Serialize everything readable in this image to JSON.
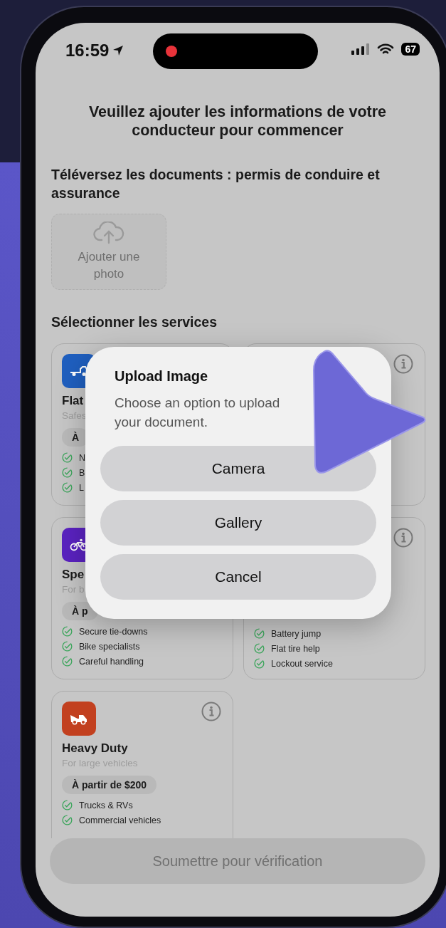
{
  "status_bar": {
    "time": "16:59",
    "battery": "67"
  },
  "title": "Veuillez ajouter les informations de votre conducteur pour commencer",
  "upload": {
    "label": "Téléversez les documents : permis de conduire et assurance",
    "button": "Ajouter une photo"
  },
  "services": {
    "heading": "Sélectionner les services",
    "cards": [
      {
        "kind": "truck",
        "color": "#1f5fbf",
        "name": "Flat",
        "subtitle": "Safes",
        "price": "À",
        "features": [
          "N",
          "B",
          "L"
        ]
      },
      {
        "kind": "hidden"
      },
      {
        "kind": "bike",
        "color": "#5a22c0",
        "name": "Spe",
        "subtitle": "For b",
        "price": "À p",
        "features": [
          "Secure tie-downs",
          "Bike specialists",
          "Careful handling"
        ]
      },
      {
        "kind": "hidden",
        "features": [
          "Battery jump",
          "Flat tire help",
          "Lockout service"
        ]
      },
      {
        "kind": "tow",
        "color": "#c2401f",
        "name": "Heavy Duty",
        "subtitle": "For large vehicles",
        "price": "À partir de $200",
        "features": [
          "Trucks & RVs",
          "Commercial vehicles"
        ]
      }
    ]
  },
  "modal": {
    "title": "Upload Image",
    "message": "Choose an option to upload your document.",
    "buttons": [
      "Camera",
      "Gallery",
      "Cancel"
    ]
  },
  "submit": {
    "label": "Soumettre pour vérification",
    "disabled": true
  }
}
